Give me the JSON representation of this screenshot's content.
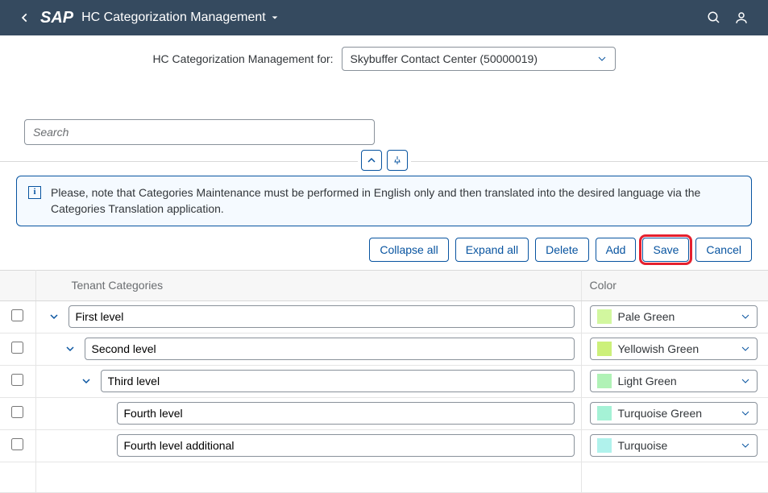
{
  "header": {
    "title": "HC Categorization Management"
  },
  "subbar": {
    "label": "HC Categorization Management for:",
    "selected": "Skybuffer Contact Center (50000019)"
  },
  "search": {
    "placeholder": "Search"
  },
  "info": {
    "text": "Please, note that Categories Maintenance must be performed in English only and then translated into the desired language via the Categories Translation application."
  },
  "toolbar": {
    "collapse": "Collapse all",
    "expand": "Expand all",
    "delete": "Delete",
    "add": "Add",
    "save": "Save",
    "cancel": "Cancel"
  },
  "columns": {
    "categories": "Tenant Categories",
    "color": "Color"
  },
  "rows": [
    {
      "value": "First level",
      "indent": 0,
      "hasChevron": true,
      "color": {
        "name": "Pale Green",
        "hex": "#d2f79f"
      }
    },
    {
      "value": "Second level",
      "indent": 1,
      "hasChevron": true,
      "color": {
        "name": "Yellowish Green",
        "hex": "#ccf07a"
      }
    },
    {
      "value": "Third level",
      "indent": 2,
      "hasChevron": true,
      "color": {
        "name": "Light Green",
        "hex": "#b0f2b6"
      }
    },
    {
      "value": "Fourth level",
      "indent": 3,
      "hasChevron": false,
      "color": {
        "name": "Turquoise Green",
        "hex": "#a5f2d6"
      }
    },
    {
      "value": "Fourth level additional",
      "indent": 3,
      "hasChevron": false,
      "color": {
        "name": "Turquoise",
        "hex": "#b0f2ec"
      }
    }
  ]
}
